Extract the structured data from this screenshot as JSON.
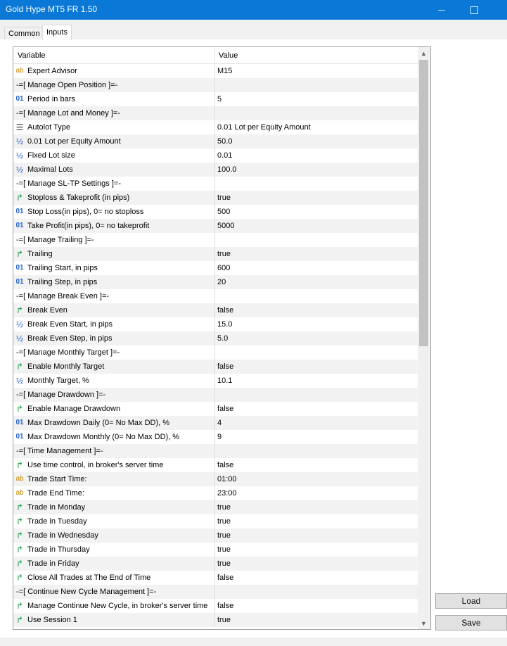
{
  "window": {
    "title": "Gold Hype MT5 FR 1.50",
    "minimize_symbol": "—",
    "close_symbol": ""
  },
  "tabs": [
    {
      "label": "Common"
    },
    {
      "label": "Inputs"
    }
  ],
  "grid": {
    "header": {
      "variable": "Variable",
      "value": "Value"
    },
    "rows": [
      {
        "icon": "ab",
        "name": "Expert Advisor",
        "value": "M15"
      },
      {
        "section": true,
        "name": "-=[ Manage Open Position ]=-",
        "value": ""
      },
      {
        "icon": "num",
        "name": "Period in bars",
        "value": "5"
      },
      {
        "section": true,
        "name": "-=[ Manage Lot and Money ]=-",
        "value": ""
      },
      {
        "icon": "list",
        "name": "Autolot Type",
        "value": "0.01 Lot per Equity Amount"
      },
      {
        "icon": "half",
        "name": "0.01 Lot per Equity Amount",
        "value": "50.0"
      },
      {
        "icon": "half",
        "name": "Fixed Lot size",
        "value": "0.01"
      },
      {
        "icon": "half",
        "name": "Maximal Lots",
        "value": "100.0"
      },
      {
        "section": true,
        "name": "-=[ Manage SL-TP Settings ]=-",
        "value": ""
      },
      {
        "icon": "bool",
        "name": "Stoploss & Takeprofit (in pips)",
        "value": "true"
      },
      {
        "icon": "num",
        "name": "Stop Loss(in pips), 0= no stoploss",
        "value": "500"
      },
      {
        "icon": "num",
        "name": "Take Profit(in pips), 0= no takeprofit",
        "value": "5000"
      },
      {
        "section": true,
        "name": "-=[ Manage Trailing ]=-",
        "value": ""
      },
      {
        "icon": "bool",
        "name": "Trailing",
        "value": "true"
      },
      {
        "icon": "num",
        "name": "Trailing Start, in pips",
        "value": "600"
      },
      {
        "icon": "num",
        "name": "Trailing Step, in pips",
        "value": "20"
      },
      {
        "section": true,
        "name": "-=[ Manage Break Even ]=-",
        "value": ""
      },
      {
        "icon": "bool",
        "name": "Break Even",
        "value": "false"
      },
      {
        "icon": "half",
        "name": "Break Even Start, in pips",
        "value": "15.0"
      },
      {
        "icon": "half",
        "name": "Break Even Step, in pips",
        "value": "5.0"
      },
      {
        "section": true,
        "name": "-=[ Manage Monthly Target ]=-",
        "value": ""
      },
      {
        "icon": "bool",
        "name": "Enable Monthly Target",
        "value": "false"
      },
      {
        "icon": "half",
        "name": "Monthly Target, %",
        "value": "10.1"
      },
      {
        "section": true,
        "name": "-=[ Manage Drawdown ]=-",
        "value": ""
      },
      {
        "icon": "bool",
        "name": "Enable Manage Drawdown",
        "value": "false"
      },
      {
        "icon": "num",
        "name": "Max Drawdown Daily (0= No Max DD), %",
        "value": "4"
      },
      {
        "icon": "num",
        "name": "Max Drawdown Monthly (0= No Max DD), %",
        "value": "9"
      },
      {
        "section": true,
        "name": "-=[ Time Management ]=-",
        "value": ""
      },
      {
        "icon": "bool",
        "name": "Use time control, in broker's server time",
        "value": "false"
      },
      {
        "icon": "ab",
        "name": "Trade Start Time:",
        "value": "01:00"
      },
      {
        "icon": "ab",
        "name": "Trade End Time:",
        "value": "23:00"
      },
      {
        "icon": "bool",
        "name": "Trade in Monday",
        "value": "true"
      },
      {
        "icon": "bool",
        "name": "Trade in Tuesday",
        "value": "true"
      },
      {
        "icon": "bool",
        "name": "Trade in Wednesday",
        "value": "true"
      },
      {
        "icon": "bool",
        "name": "Trade in Thursday",
        "value": "true"
      },
      {
        "icon": "bool",
        "name": "Trade in Friday",
        "value": "true"
      },
      {
        "icon": "bool",
        "name": "Close All Trades at The End of Time",
        "value": "false"
      },
      {
        "section": true,
        "name": "-=[ Continue New Cycle Management ]=-",
        "value": ""
      },
      {
        "icon": "bool",
        "name": "Manage Continue New Cycle, in broker's server time",
        "value": "false"
      },
      {
        "icon": "bool",
        "name": "Use Session 1",
        "value": "true"
      }
    ]
  },
  "icons": {
    "ab": "ab",
    "num": "01",
    "half": "½",
    "bool": "↱",
    "list": "☰"
  },
  "buttons": {
    "load": "Load",
    "save": "Save"
  },
  "colors": {
    "titlebar": "#0a78d7",
    "alt_row": "#f2f2f2"
  }
}
